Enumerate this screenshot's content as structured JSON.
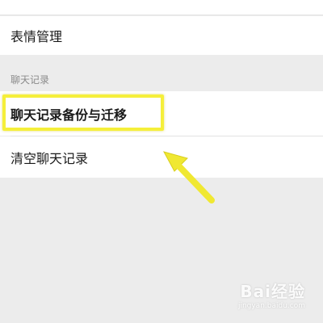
{
  "settings": {
    "emoji_row": {
      "label": "表情管理"
    },
    "chat_history_section": {
      "header": "聊天记录"
    },
    "backup_row": {
      "label": "聊天记录备份与迁移"
    },
    "clear_row": {
      "label": "清空聊天记录"
    }
  },
  "annotation": {
    "highlight_color": "#f5ef3a",
    "arrow_color": "#f0e832",
    "arrow_target": "backup_row"
  },
  "watermark": {
    "brand": "Bai经验",
    "url": "jingyan.baidu.com"
  }
}
